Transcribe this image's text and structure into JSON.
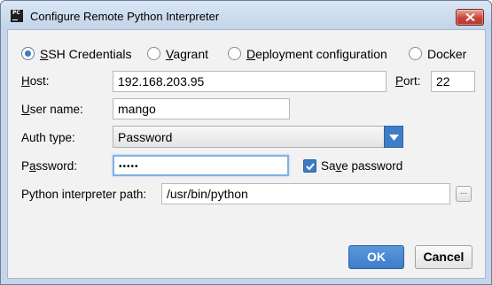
{
  "window": {
    "app_icon_text": "PC",
    "title": "Configure Remote Python Interpreter"
  },
  "tabs": [
    {
      "mnemonic": "S",
      "rest": "SH Credentials",
      "selected": true
    },
    {
      "mnemonic": "V",
      "rest": "agrant",
      "selected": false
    },
    {
      "mnemonic": "D",
      "rest": "eployment configuration",
      "selected": false
    },
    {
      "mnemonic": "",
      "rest": "Docker",
      "selected": false
    }
  ],
  "form": {
    "host_label_mn": "H",
    "host_label_rest": "ost:",
    "host_value": "192.168.203.95",
    "port_label_mn": "P",
    "port_label_rest": "ort:",
    "port_value": "22",
    "username_label_mn": "U",
    "username_label_rest": "ser name:",
    "username_value": "mango",
    "authtype_label": "Auth type:",
    "authtype_value": "Password",
    "password_label_pre": "P",
    "password_label_mn": "a",
    "password_label_rest": "ssword:",
    "password_value": "•••••",
    "save_password_pre": "Sa",
    "save_password_mn": "v",
    "save_password_rest": "e password",
    "save_password_checked": true,
    "interpreter_label": "Python interpreter path:",
    "interpreter_value": "/usr/bin/python",
    "browse_label": "..."
  },
  "buttons": {
    "ok": "OK",
    "cancel": "Cancel"
  },
  "colors": {
    "accent": "#3d7ac1",
    "close": "#c8443a"
  }
}
